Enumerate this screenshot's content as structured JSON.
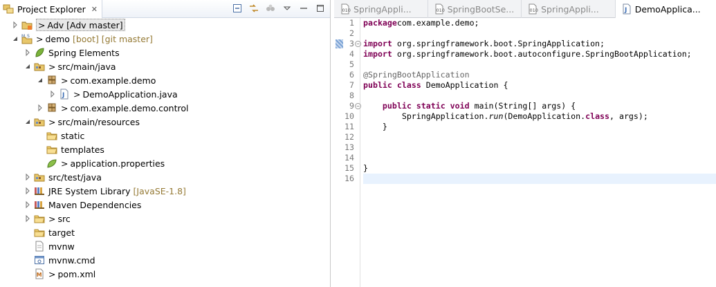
{
  "explorer": {
    "title": "Project Explorer",
    "close_symbol": "✕",
    "tree": [
      {
        "label": "Adv",
        "prefix": ">",
        "decoration": "[Adv master]",
        "decoration_plain": true,
        "level": 0,
        "twisty": "collapsed",
        "icon": "project-icon",
        "selected": true
      },
      {
        "label": "demo",
        "prefix": ">",
        "decoration": "[boot] [git master]",
        "level": 0,
        "twisty": "expanded",
        "icon": "maven-project-icon"
      },
      {
        "label": "Spring Elements",
        "prefix": "",
        "decoration": "",
        "level": 1,
        "twisty": "collapsed",
        "icon": "spring-leaf-icon"
      },
      {
        "label": "src/main/java",
        "prefix": ">",
        "decoration": "",
        "level": 1,
        "twisty": "expanded",
        "icon": "source-folder-icon"
      },
      {
        "label": "com.example.demo",
        "prefix": ">",
        "decoration": "",
        "level": 2,
        "twisty": "expanded",
        "icon": "package-icon"
      },
      {
        "label": "DemoApplication.java",
        "prefix": ">",
        "decoration": "",
        "level": 3,
        "twisty": "collapsed",
        "icon": "java-file-icon"
      },
      {
        "label": "com.example.demo.control",
        "prefix": ">",
        "decoration": "",
        "level": 2,
        "twisty": "collapsed",
        "icon": "package-icon"
      },
      {
        "label": "src/main/resources",
        "prefix": ">",
        "decoration": "",
        "level": 1,
        "twisty": "expanded",
        "icon": "source-folder-icon"
      },
      {
        "label": "static",
        "prefix": "",
        "decoration": "",
        "level": 2,
        "twisty": "none",
        "icon": "folder-icon"
      },
      {
        "label": "templates",
        "prefix": "",
        "decoration": "",
        "level": 2,
        "twisty": "none",
        "icon": "folder-icon"
      },
      {
        "label": "application.properties",
        "prefix": ">",
        "decoration": "",
        "level": 2,
        "twisty": "none",
        "icon": "properties-file-icon"
      },
      {
        "label": "src/test/java",
        "prefix": "",
        "decoration": "",
        "level": 1,
        "twisty": "collapsed",
        "icon": "source-folder-icon"
      },
      {
        "label": "JRE System Library",
        "prefix": "",
        "decoration": "[JavaSE-1.8]",
        "level": 1,
        "twisty": "collapsed",
        "icon": "library-icon"
      },
      {
        "label": "Maven Dependencies",
        "prefix": "",
        "decoration": "",
        "level": 1,
        "twisty": "collapsed",
        "icon": "library-icon"
      },
      {
        "label": "src",
        "prefix": ">",
        "decoration": "",
        "level": 1,
        "twisty": "collapsed",
        "icon": "folder-icon"
      },
      {
        "label": "target",
        "prefix": "",
        "decoration": "",
        "level": 1,
        "twisty": "none",
        "icon": "folder-icon"
      },
      {
        "label": "mvnw",
        "prefix": "",
        "decoration": "",
        "level": 1,
        "twisty": "none",
        "icon": "file-icon"
      },
      {
        "label": "mvnw.cmd",
        "prefix": "",
        "decoration": "",
        "level": 1,
        "twisty": "none",
        "icon": "cmd-file-icon"
      },
      {
        "label": "pom.xml",
        "prefix": ">",
        "decoration": "",
        "level": 1,
        "twisty": "none",
        "icon": "xml-file-icon"
      }
    ]
  },
  "editor": {
    "tabs": [
      {
        "label": "SpringAppli...",
        "icon": "class-file-icon",
        "active": false
      },
      {
        "label": "SpringBootSe...",
        "icon": "class-file-icon",
        "active": false
      },
      {
        "label": "SpringAppli...",
        "icon": "class-file-icon",
        "active": false
      },
      {
        "label": "DemoApplica...",
        "icon": "java-file-icon",
        "active": true
      }
    ],
    "lines": [
      {
        "n": "1",
        "parts": [
          [
            "kw",
            "package"
          ],
          [
            "",
            "com.example.demo;"
          ]
        ]
      },
      {
        "n": "2",
        "parts": []
      },
      {
        "n": "3",
        "fold": true,
        "mark": true,
        "parts": [
          [
            "kw",
            "import"
          ],
          [
            "",
            " org.springframework.boot.SpringApplication;"
          ]
        ]
      },
      {
        "n": "4",
        "parts": [
          [
            "kw",
            "import"
          ],
          [
            "",
            " org.springframework.boot.autoconfigure.SpringBootApplication;"
          ]
        ]
      },
      {
        "n": "5",
        "parts": []
      },
      {
        "n": "6",
        "parts": [
          [
            "ann",
            "@SpringBootApplication"
          ]
        ]
      },
      {
        "n": "7",
        "parts": [
          [
            "kw",
            "public"
          ],
          [
            "",
            " "
          ],
          [
            "kw",
            "class"
          ],
          [
            "",
            " DemoApplication {"
          ]
        ]
      },
      {
        "n": "8",
        "parts": []
      },
      {
        "n": "9",
        "fold": true,
        "parts": [
          [
            "",
            "    "
          ],
          [
            "kw",
            "public"
          ],
          [
            "",
            " "
          ],
          [
            "kw",
            "static"
          ],
          [
            "",
            " "
          ],
          [
            "kw",
            "void"
          ],
          [
            "",
            " main(String[] args) {"
          ]
        ]
      },
      {
        "n": "10",
        "parts": [
          [
            "",
            "        SpringApplication."
          ],
          [
            "it",
            "run"
          ],
          [
            "",
            "(DemoApplication."
          ],
          [
            "kw",
            "class"
          ],
          [
            "",
            ", args);"
          ]
        ]
      },
      {
        "n": "11",
        "parts": [
          [
            "",
            "    }"
          ]
        ]
      },
      {
        "n": "12",
        "parts": []
      },
      {
        "n": "13",
        "parts": []
      },
      {
        "n": "14",
        "parts": []
      },
      {
        "n": "15",
        "parts": [
          [
            "",
            "}"
          ]
        ]
      },
      {
        "n": "16",
        "current": true,
        "parts": []
      }
    ]
  },
  "colors": {
    "keyword": "#7f0055",
    "annotation": "#646464",
    "decoration": "#957a35",
    "current_line": "#e8f2fe"
  }
}
